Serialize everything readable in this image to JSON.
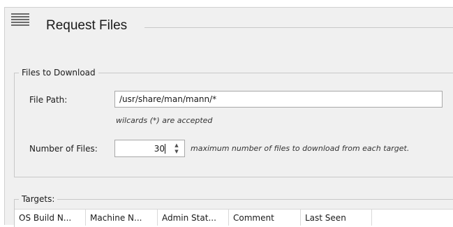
{
  "header": {
    "title": "Request Files",
    "icon": "menu-lines-icon"
  },
  "files_group": {
    "legend": "Files to Download",
    "file_path": {
      "label": "File Path:",
      "value": "/usr/share/man/mann/*",
      "hint": "wilcards (*) are accepted"
    },
    "number_of_files": {
      "label": "Number of Files:",
      "value": "30",
      "hint": "maximum number of files to download from each target."
    }
  },
  "targets_group": {
    "legend": "Targets:",
    "columns": [
      "OS Build N...",
      "Machine N...",
      "Admin Stat...",
      "Comment",
      "Last Seen"
    ]
  },
  "colors": {
    "dialog_bg": "#f0f0f0",
    "border": "#c8c8c8",
    "input_border": "#a8a8a8"
  }
}
